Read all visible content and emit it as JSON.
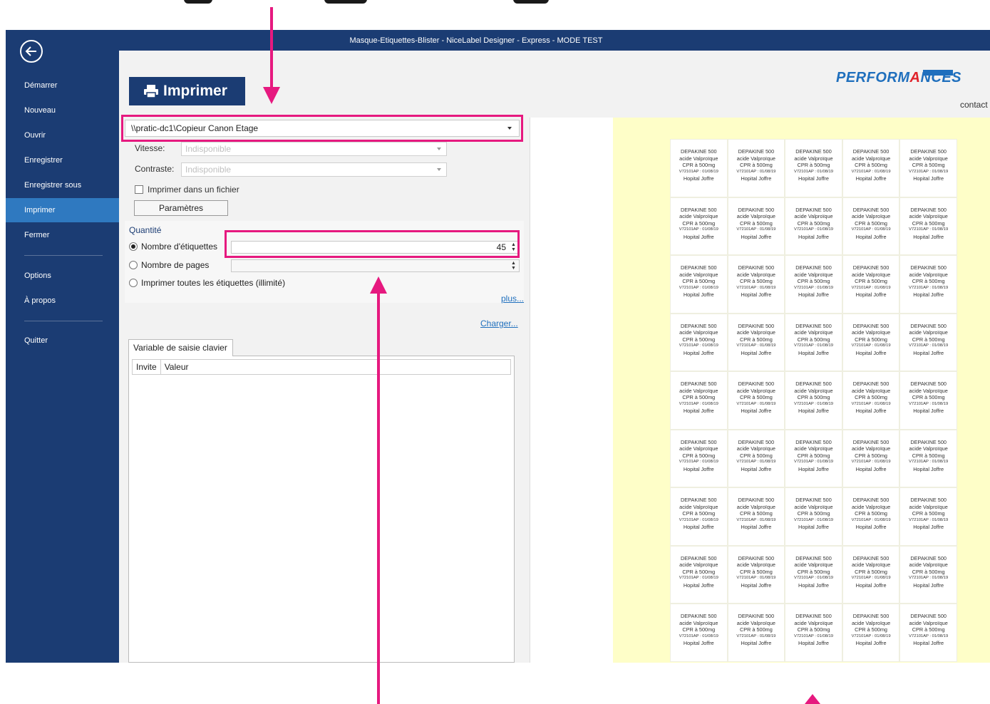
{
  "window": {
    "title": "Masque-Etiquettes-Blister - NiceLabel Designer - Express - MODE TEST"
  },
  "sidebar": {
    "items": [
      {
        "label": "Démarrer"
      },
      {
        "label": "Nouveau"
      },
      {
        "label": "Ouvrir"
      },
      {
        "label": "Enregistrer"
      },
      {
        "label": "Enregistrer sous"
      },
      {
        "label": "Imprimer",
        "active": true
      },
      {
        "label": "Fermer"
      },
      {
        "label": "Options"
      },
      {
        "label": "À propos"
      },
      {
        "label": "Quitter"
      }
    ]
  },
  "print": {
    "heading": "Imprimer",
    "printer": "\\\\pratic-dc1\\Copieur Canon Etage",
    "speed_label": "Vitesse:",
    "speed_value": "Indisponible",
    "contrast_label": "Contraste:",
    "contrast_value": "Indisponible",
    "print_to_file_label": "Imprimer dans un fichier",
    "params_button": "Paramètres"
  },
  "quantity": {
    "title": "Quantité",
    "options": [
      {
        "label": "Nombre d'étiquettes",
        "selected": true
      },
      {
        "label": "Nombre de pages",
        "selected": false
      },
      {
        "label": "Imprimer toutes les étiquettes (illimité)",
        "selected": false
      }
    ],
    "labels_count": "45",
    "more_link": "plus..."
  },
  "variables": {
    "tab_label": "Variable de saisie clavier",
    "load_link": "Charger...",
    "columns": [
      "Invite",
      "Valeur"
    ]
  },
  "branding": {
    "logo_pre": "PERFORM",
    "logo_a": "A",
    "logo_post": "NCES",
    "contact": "contact"
  },
  "preview": {
    "rows": 9,
    "cols": 5,
    "label_lines": [
      "DEPAKINE 500",
      "acide Valproïque",
      "CPR à 500mg",
      "V72101AP : 01/08/19",
      "Hopital Joffre"
    ]
  },
  "colors": {
    "sidebar_bg": "#1b3c73",
    "active_item": "#2f79c0",
    "annotation": "#e6197f",
    "preview_page": "#fefec8"
  }
}
